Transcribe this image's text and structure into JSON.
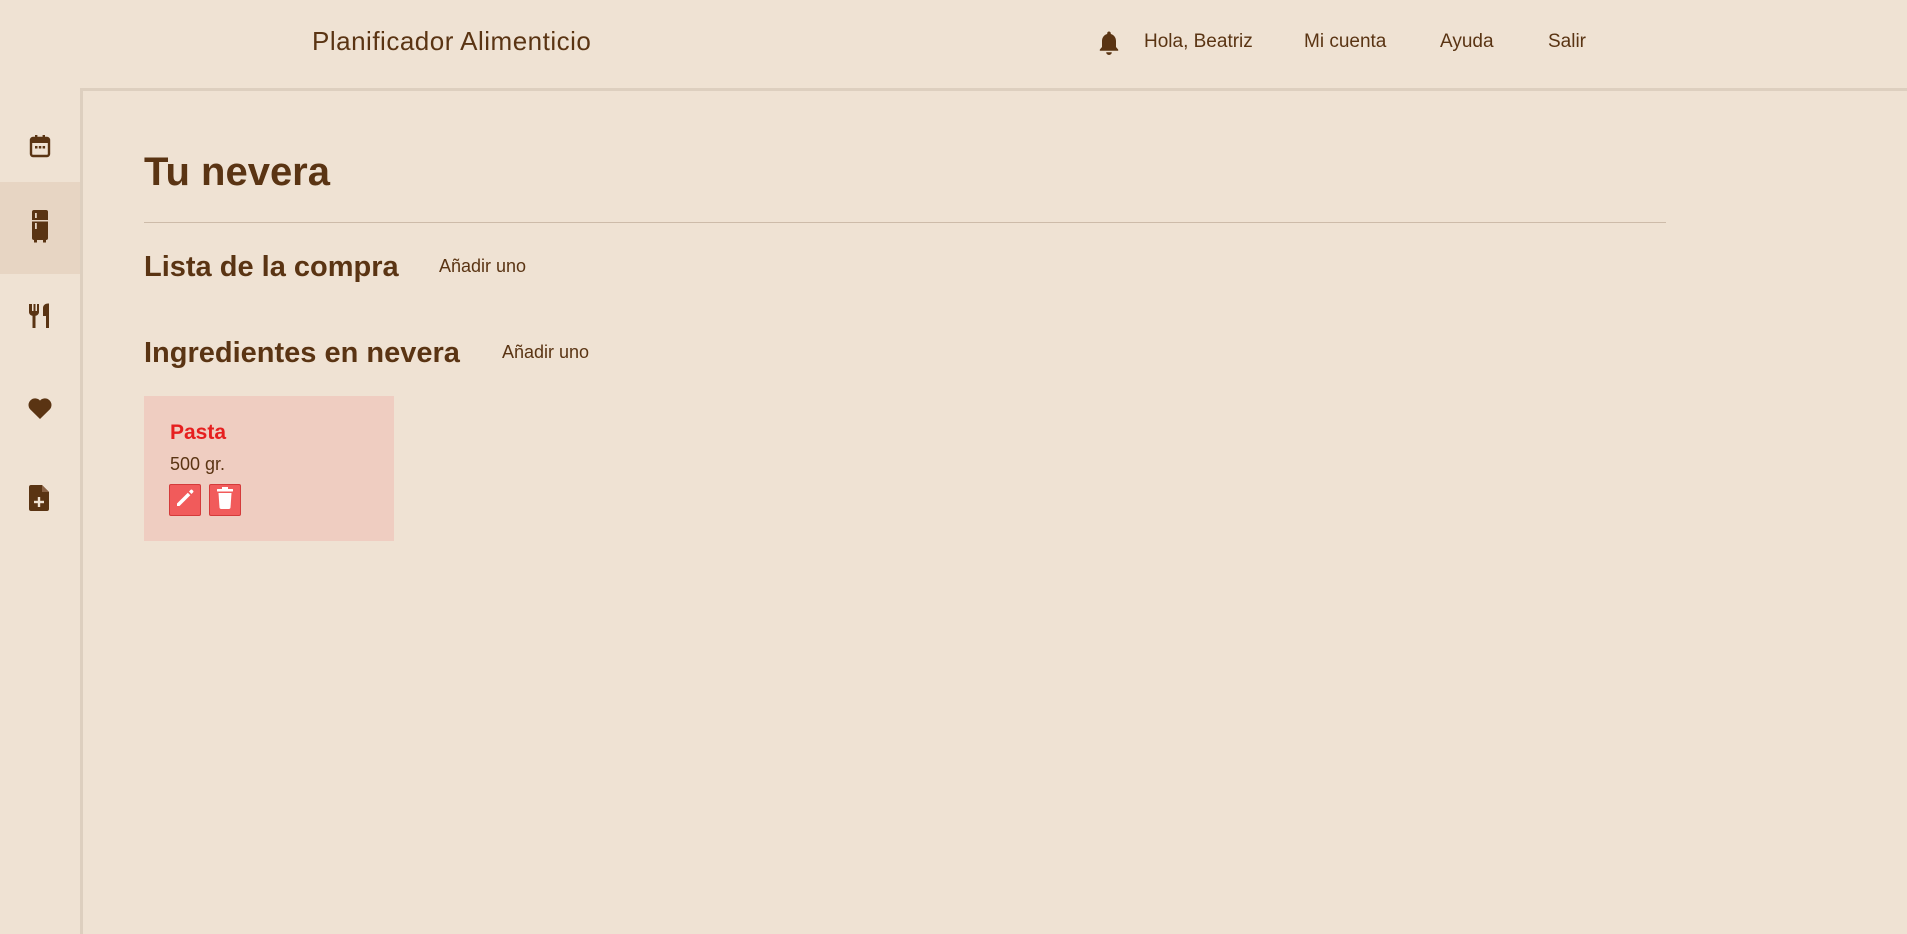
{
  "header": {
    "app_title": "Planificador Alimenticio",
    "greeting": "Hola, Beatriz",
    "account_link": "Mi cuenta",
    "help_link": "Ayuda",
    "logout_link": "Salir"
  },
  "sidebar": {
    "items": [
      {
        "icon": "calendar-icon",
        "active": false
      },
      {
        "icon": "fridge-icon",
        "active": true
      },
      {
        "icon": "cutlery-icon",
        "active": false
      },
      {
        "icon": "heart-icon",
        "active": false
      },
      {
        "icon": "file-add-icon",
        "active": false
      }
    ]
  },
  "main": {
    "page_title": "Tu nevera",
    "shopping_list": {
      "title": "Lista de la compra",
      "add_label": "Añadir uno"
    },
    "fridge_ingredients": {
      "title": "Ingredientes en nevera",
      "add_label": "Añadir uno",
      "items": [
        {
          "name": "Pasta",
          "quantity": "500 gr."
        }
      ]
    }
  },
  "colors": {
    "background": "#efe2d3",
    "text": "#5a3413",
    "card_bg": "#efcdc1",
    "accent_red": "#e61f1f",
    "button_red": "#f15b5b"
  }
}
